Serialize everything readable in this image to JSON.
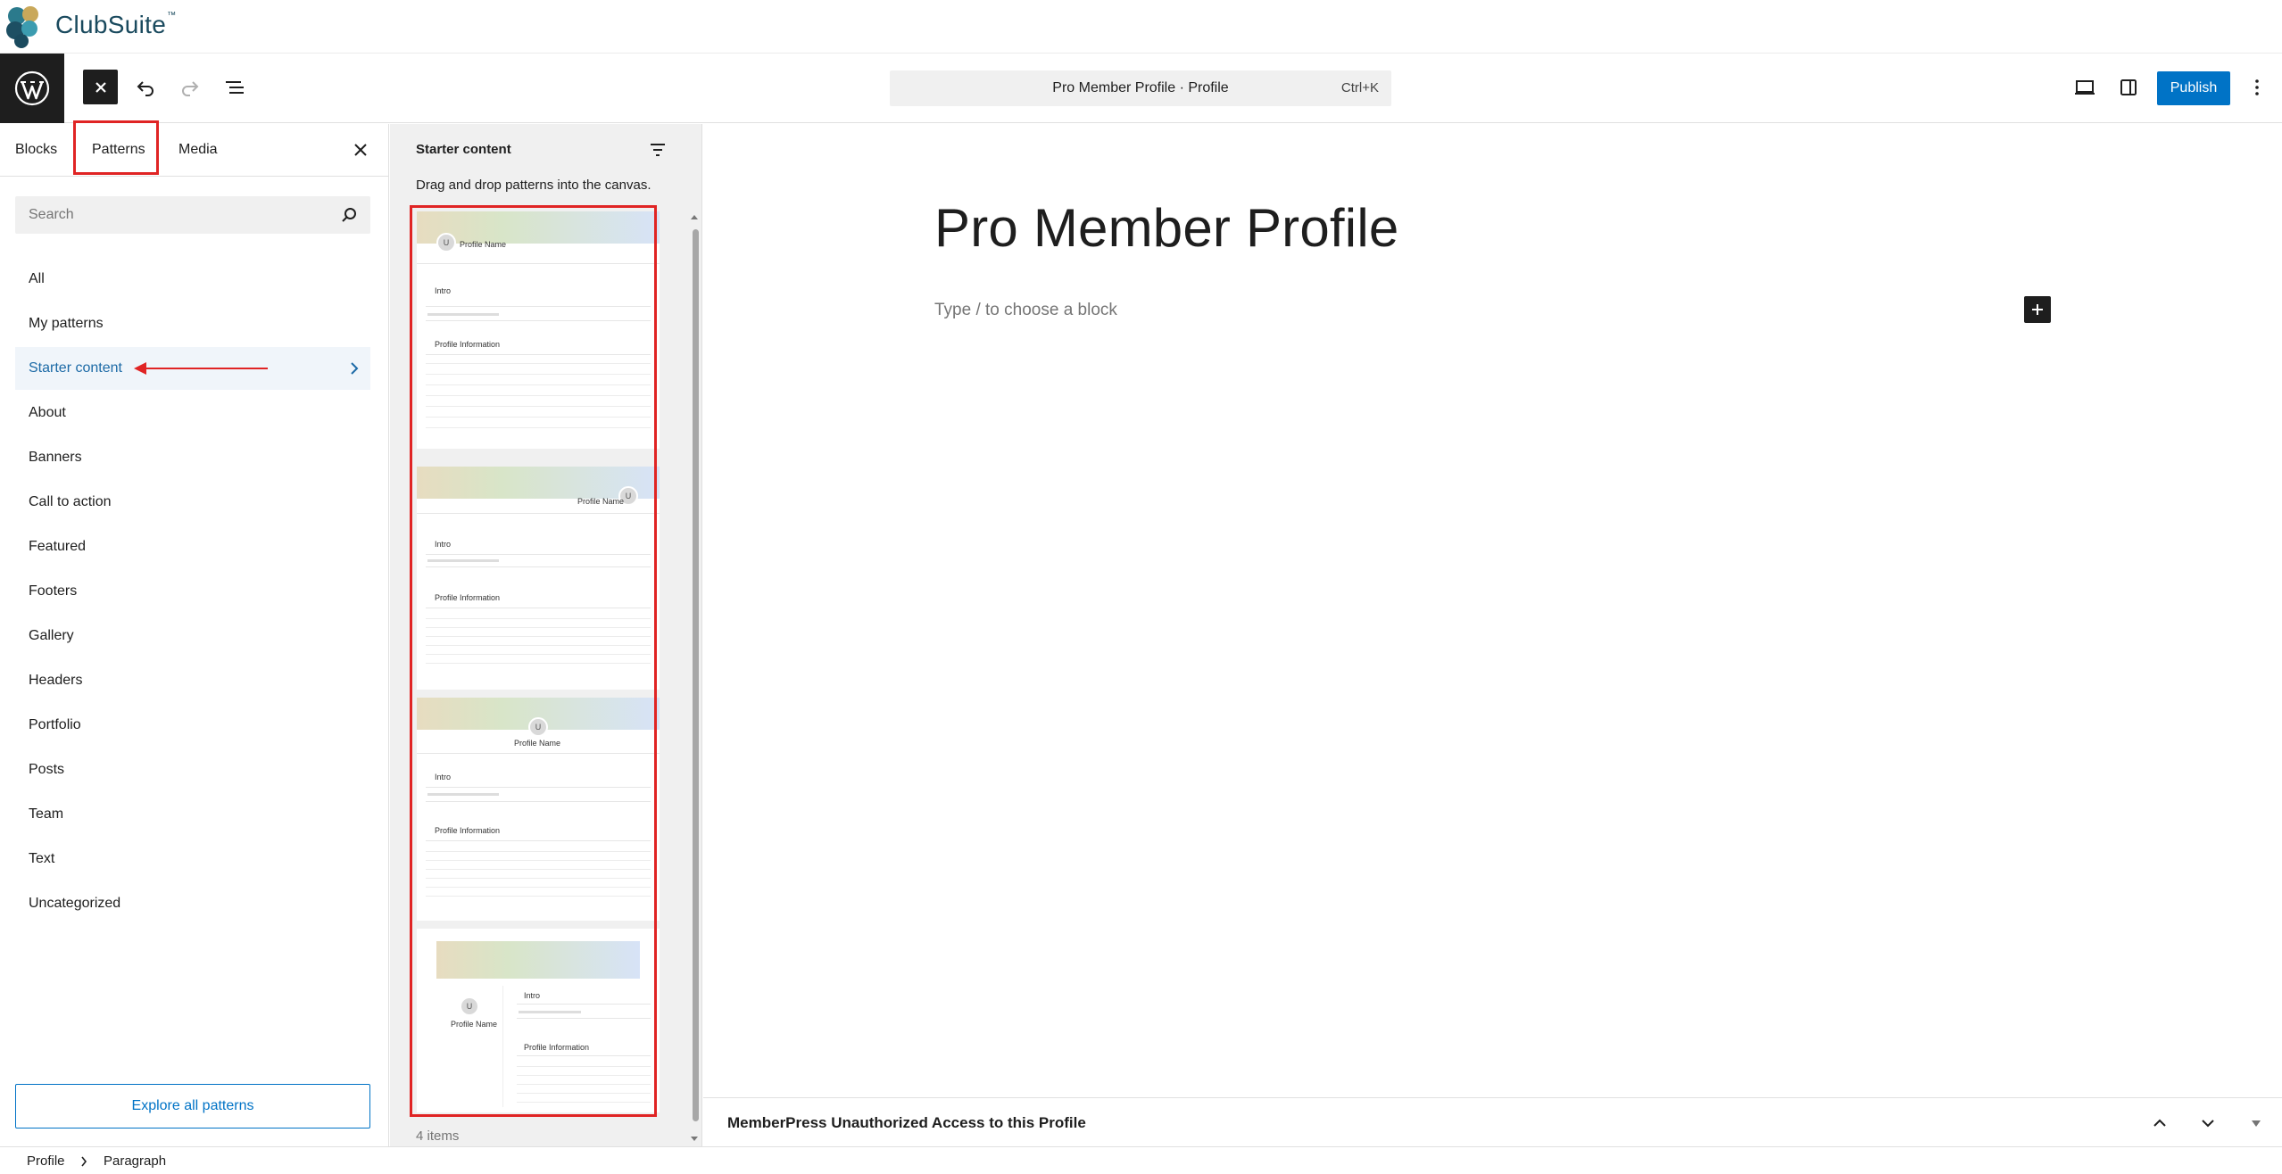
{
  "brand": {
    "name": "ClubSuite",
    "tm": "™"
  },
  "toolbar": {
    "command_title": "Pro Member Profile · Profile",
    "command_shortcut": "Ctrl+K",
    "publish_label": "Publish"
  },
  "sidebar": {
    "tabs": [
      {
        "label": "Blocks"
      },
      {
        "label": "Patterns"
      },
      {
        "label": "Media"
      }
    ],
    "search_placeholder": "Search",
    "categories": [
      {
        "label": "All"
      },
      {
        "label": "My patterns"
      },
      {
        "label": "Starter content"
      },
      {
        "label": "About"
      },
      {
        "label": "Banners"
      },
      {
        "label": "Call to action"
      },
      {
        "label": "Featured"
      },
      {
        "label": "Footers"
      },
      {
        "label": "Gallery"
      },
      {
        "label": "Headers"
      },
      {
        "label": "Portfolio"
      },
      {
        "label": "Posts"
      },
      {
        "label": "Team"
      },
      {
        "label": "Text"
      },
      {
        "label": "Uncategorized"
      }
    ],
    "explore_label": "Explore all patterns"
  },
  "patterns_panel": {
    "title": "Starter content",
    "description": "Drag and drop patterns into the canvas.",
    "count_label": "4 items",
    "card_text": {
      "avatar": "U",
      "profile_name": "Profile Name",
      "intro": "Intro",
      "profile_info": "Profile Information"
    }
  },
  "canvas": {
    "title": "Pro Member Profile",
    "placeholder": "Type / to choose a block"
  },
  "metabox": {
    "title": "MemberPress Unauthorized Access to this Profile"
  },
  "footer": {
    "breadcrumbs": [
      {
        "label": "Profile"
      },
      {
        "label": "Paragraph"
      }
    ]
  },
  "colors": {
    "accent": "#0073c6",
    "highlight_box": "#e02424",
    "active_text": "#1c6aa6"
  }
}
